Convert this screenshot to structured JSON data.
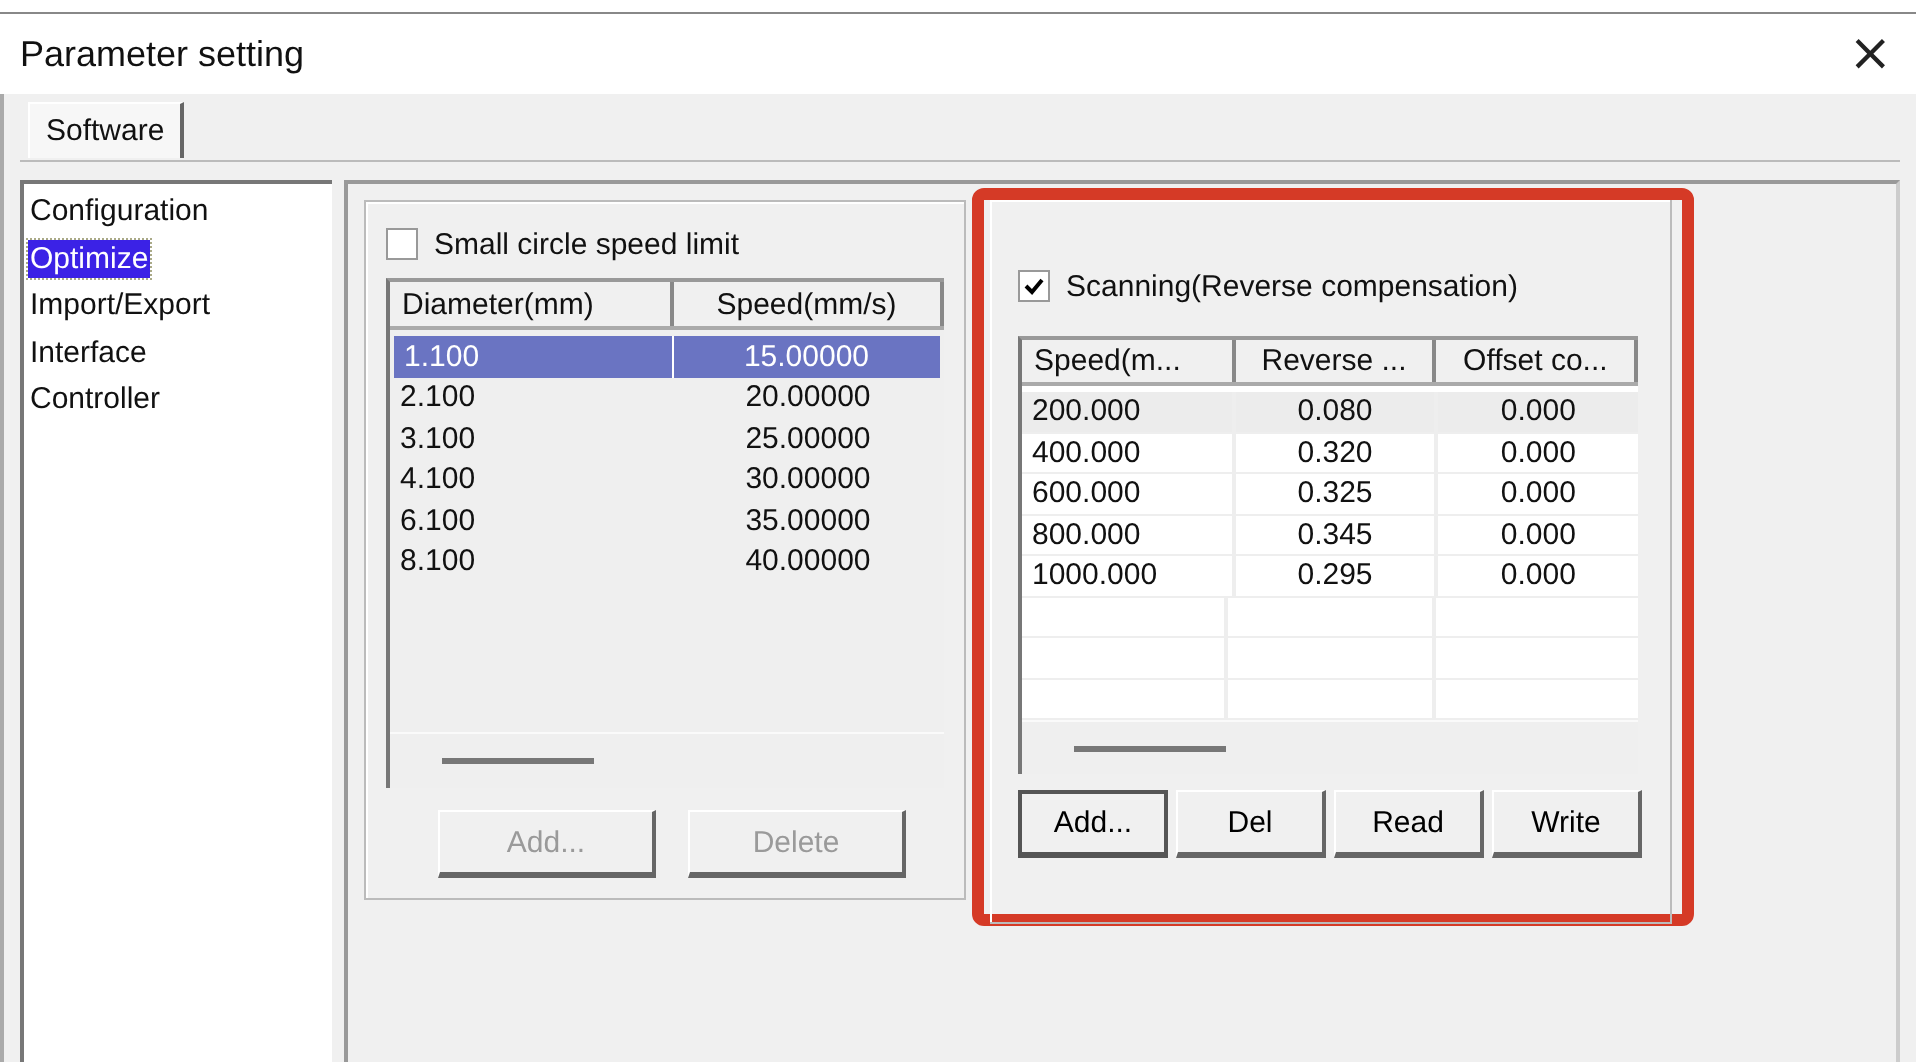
{
  "window": {
    "title": "Parameter setting",
    "close": "×"
  },
  "tabs": [
    {
      "label": "Software",
      "selected": true
    }
  ],
  "sidebar": {
    "items": [
      {
        "label": "Configuration",
        "selected": false
      },
      {
        "label": "Optimize",
        "selected": true
      },
      {
        "label": "Import/Export",
        "selected": false
      },
      {
        "label": "Interface",
        "selected": false
      },
      {
        "label": "Controller",
        "selected": false
      }
    ]
  },
  "small_circle": {
    "label": "Small circle speed limit",
    "checked": false,
    "table": {
      "columns": [
        "Diameter(mm)",
        "Speed(mm/s)"
      ],
      "rows": [
        {
          "cells": [
            "1.100",
            "15.00000"
          ],
          "selected": true
        },
        {
          "cells": [
            "2.100",
            "20.00000"
          ],
          "selected": false
        },
        {
          "cells": [
            "3.100",
            "25.00000"
          ],
          "selected": false
        },
        {
          "cells": [
            "4.100",
            "30.00000"
          ],
          "selected": false
        },
        {
          "cells": [
            "6.100",
            "35.00000"
          ],
          "selected": false
        },
        {
          "cells": [
            "8.100",
            "40.00000"
          ],
          "selected": false
        }
      ]
    },
    "buttons": [
      {
        "label": "Add...",
        "disabled": true
      },
      {
        "label": "Delete",
        "disabled": true
      }
    ]
  },
  "scanning": {
    "highlighted": true,
    "label": "Scanning(Reverse compensation)",
    "checked": true,
    "table": {
      "columns": [
        "Speed(m...",
        "Reverse ...",
        "Offset co..."
      ],
      "rows": [
        {
          "cells": [
            "200.000",
            "0.080",
            "0.000"
          ],
          "selected": true
        },
        {
          "cells": [
            "400.000",
            "0.320",
            "0.000"
          ],
          "selected": false
        },
        {
          "cells": [
            "600.000",
            "0.325",
            "0.000"
          ],
          "selected": false
        },
        {
          "cells": [
            "800.000",
            "0.345",
            "0.000"
          ],
          "selected": false
        },
        {
          "cells": [
            "1000.000",
            "0.295",
            "0.000"
          ],
          "selected": false
        }
      ]
    },
    "buttons": [
      {
        "label": "Add...",
        "disabled": false,
        "focused": true
      },
      {
        "label": "Del",
        "disabled": false,
        "focused": false
      },
      {
        "label": "Read",
        "disabled": false,
        "focused": false
      },
      {
        "label": "Write",
        "disabled": false,
        "focused": false
      }
    ]
  }
}
